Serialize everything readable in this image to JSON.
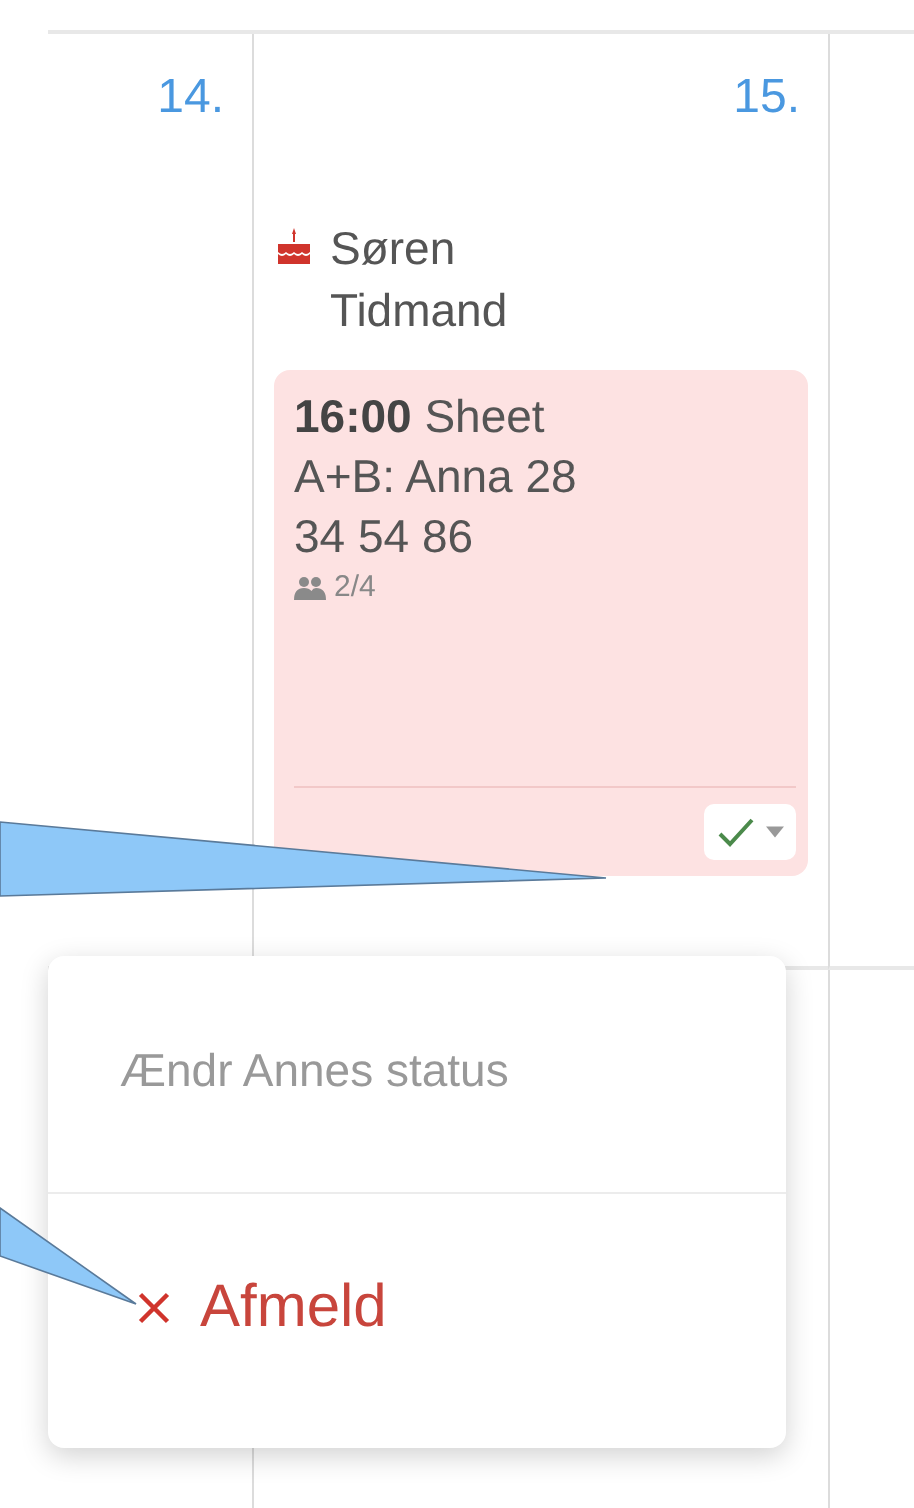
{
  "days": [
    {
      "label": "14."
    },
    {
      "label": "15.",
      "birthdays": [
        {
          "name": "Søren Tidmand"
        }
      ],
      "events": [
        {
          "text": "**16:00** Sheet A+B: Anna 28 34 54 86",
          "attendees": "2/4",
          "confirmed": true
        }
      ]
    }
  ],
  "status_menu": {
    "header": "Ændr Annes status",
    "items": [
      {
        "kind": "unregister",
        "label": "Afmeld"
      }
    ]
  }
}
